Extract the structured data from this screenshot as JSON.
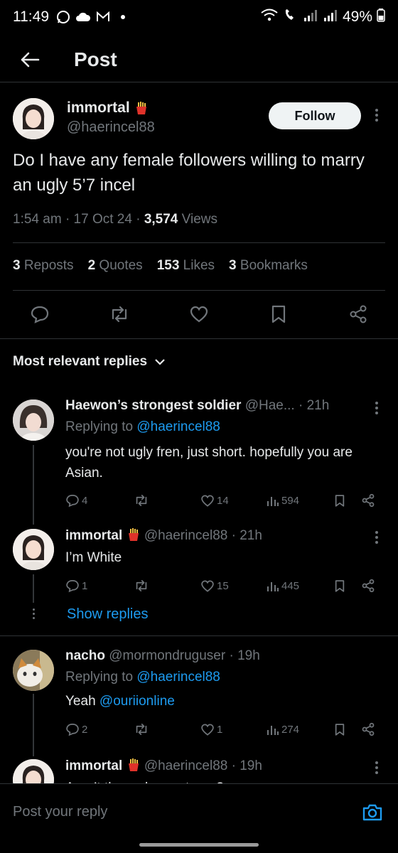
{
  "status_bar": {
    "time": "11:49",
    "battery": "49%",
    "left_icons": [
      "whatsapp-icon",
      "cloud-icon",
      "gmail-icon",
      "dot-icon"
    ],
    "right_icons": [
      "wifi-icon",
      "call-icon",
      "signal-icon",
      "signal-icon",
      "battery-icon"
    ]
  },
  "header": {
    "title": "Post"
  },
  "post": {
    "display_name": "immortal",
    "handle": "@haerincel88",
    "follow_label": "Follow",
    "text": "Do I have any female followers willing to marry an ugly 5’7 incel",
    "time": "1:54 am",
    "date": "17 Oct 24",
    "views_count": "3,574",
    "views_label": "Views",
    "stats": [
      {
        "count": "3",
        "label": "Reposts"
      },
      {
        "count": "2",
        "label": "Quotes"
      },
      {
        "count": "153",
        "label": "Likes"
      },
      {
        "count": "3",
        "label": "Bookmarks"
      }
    ]
  },
  "replies_header": {
    "label": "Most relevant replies"
  },
  "replies": [
    {
      "display_name": "Haewon’s strongest soldier",
      "handle": "@Hae...",
      "time": "21h",
      "replying_prefix": "Replying to",
      "replying_to": "@haerincel88",
      "text": "you're not ugly fren, just short. hopefully you are Asian.",
      "replies": "4",
      "reposts": "",
      "likes": "14",
      "views": "594"
    },
    {
      "display_name": "immortal",
      "handle": "@haerincel88",
      "time": "21h",
      "text": "I’m White",
      "replies": "1",
      "reposts": "",
      "likes": "15",
      "views": "445"
    },
    {
      "display_name": "nacho",
      "handle": "@mormondruguser",
      "time": "19h",
      "replying_prefix": "Replying to",
      "replying_to": "@haerincel88",
      "text_prefix": "Yeah",
      "mention": "@ouriionline",
      "replies": "2",
      "reposts": "",
      "likes": "1",
      "views": "274"
    },
    {
      "display_name": "immortal",
      "handle": "@haerincel88",
      "time": "19h",
      "text": "Aren’t they a brown troop?"
    }
  ],
  "show_replies": "Show replies",
  "composer": {
    "placeholder": "Post your reply"
  },
  "colors": {
    "background": "#000000",
    "accent": "#1d9bf0",
    "muted": "#71767b",
    "text": "#e7e9ea"
  }
}
